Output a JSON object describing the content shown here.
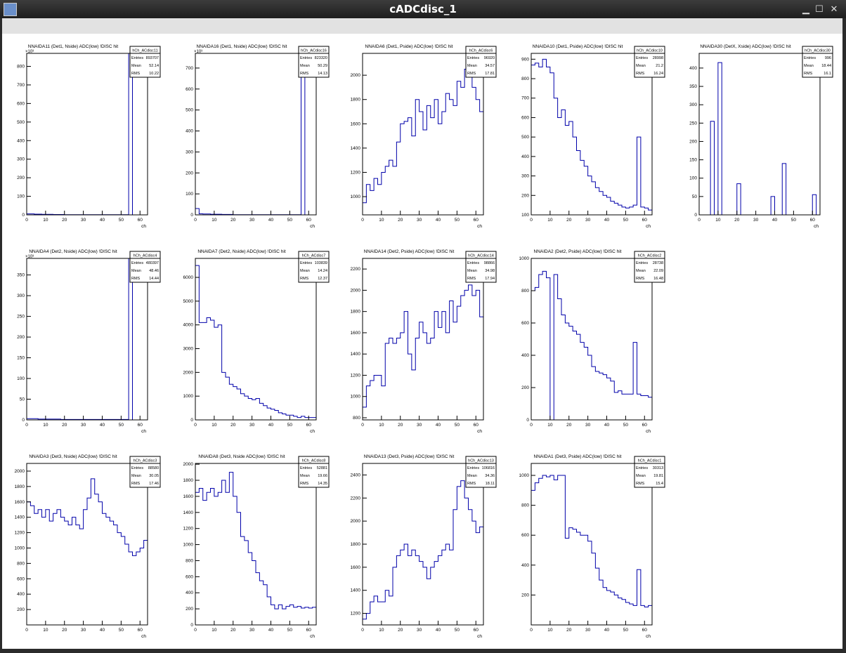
{
  "window": {
    "title": "cADCdisc_1",
    "buttons": {
      "minimize": "▁",
      "maximize": "☐",
      "close": "✕"
    }
  },
  "colors": {
    "line": "#0000aa"
  },
  "chart_data": [
    {
      "type": "bar",
      "title": "NNAIDA11 (Det1, Nside) ADC(low) !DISC hit",
      "stat_name": "hCh_ACdisc11",
      "entries": "893707",
      "mean": "52.14",
      "rms": "10.22",
      "xlabel": "ch",
      "exponent": "×10³",
      "ylim": [
        0,
        870
      ],
      "yticks": [
        0,
        100,
        200,
        300,
        400,
        500,
        600,
        700,
        800
      ],
      "values": [
        5,
        5,
        4,
        4,
        3,
        3,
        3,
        2,
        2,
        2,
        1,
        1,
        1,
        1,
        1,
        1,
        1,
        1,
        1,
        1,
        1,
        1,
        1,
        1,
        1,
        1,
        1,
        900,
        0,
        0,
        0,
        0
      ]
    },
    {
      "type": "bar",
      "title": "NNAIDA16 (Det1, Nside) ADC(low) !DISC hit",
      "stat_name": "hCh_ACdisc16",
      "entries": "823320",
      "mean": "50.29",
      "rms": "14.13",
      "xlabel": "ch",
      "exponent": "×10³",
      "ylim": [
        0,
        770
      ],
      "yticks": [
        0,
        100,
        200,
        300,
        400,
        500,
        600,
        700
      ],
      "values": [
        30,
        5,
        4,
        4,
        3,
        3,
        3,
        2,
        2,
        2,
        1,
        1,
        1,
        1,
        1,
        1,
        1,
        1,
        1,
        1,
        1,
        1,
        1,
        1,
        1,
        1,
        1,
        1,
        800,
        0,
        0,
        0
      ]
    },
    {
      "type": "bar",
      "title": "NNAIDA6 (Det1, Pside) ADC(low) !DISC hit",
      "stat_name": "hCh_ACdisc6",
      "entries": "96920",
      "mean": "34.57",
      "rms": "17.81",
      "xlabel": "ch",
      "exponent": "",
      "ylim": [
        850,
        2180
      ],
      "yticks": [
        1000,
        1200,
        1400,
        1600,
        1800,
        2000
      ],
      "values": [
        950,
        1100,
        1050,
        1150,
        1100,
        1200,
        1250,
        1300,
        1250,
        1450,
        1600,
        1620,
        1650,
        1500,
        1800,
        1700,
        1550,
        1750,
        1650,
        1800,
        1600,
        1700,
        1850,
        1800,
        1750,
        1950,
        1900,
        2050,
        2000,
        1900,
        1800,
        1700
      ]
    },
    {
      "type": "bar",
      "title": "NNAIDA10 (Det1, Pside) ADC(low) !DISC hit",
      "stat_name": "hCh_ACdisc10",
      "entries": "28998",
      "mean": "21.2",
      "rms": "16.24",
      "xlabel": "ch",
      "exponent": "",
      "ylim": [
        100,
        930
      ],
      "yticks": [
        100,
        200,
        300,
        400,
        500,
        600,
        700,
        800,
        900
      ],
      "values": [
        870,
        880,
        860,
        900,
        860,
        830,
        700,
        600,
        640,
        560,
        580,
        500,
        430,
        380,
        350,
        300,
        270,
        240,
        220,
        200,
        190,
        170,
        160,
        150,
        140,
        135,
        140,
        150,
        500,
        140,
        135,
        125
      ]
    },
    {
      "type": "bar",
      "title": "NNAIDA30 (DetX, Xside) ADC(low) !DISC hit",
      "stat_name": "hCh_ACdisc30",
      "entries": "996",
      "mean": "18.44",
      "rms": "16.1",
      "xlabel": "ch",
      "exponent": "",
      "ylim": [
        0,
        440
      ],
      "yticks": [
        0,
        50,
        100,
        150,
        200,
        250,
        300,
        350,
        400
      ],
      "values": [
        0,
        0,
        0,
        255,
        0,
        415,
        0,
        0,
        0,
        0,
        85,
        0,
        0,
        0,
        0,
        0,
        0,
        0,
        0,
        50,
        0,
        0,
        140,
        0,
        0,
        0,
        0,
        0,
        0,
        0,
        55,
        0
      ]
    },
    {
      "type": "bar",
      "title": "NNAIDA4 (Det2, Nside) ADC(low) !DISC hit",
      "stat_name": "hCh_ACdisc4",
      "entries": "480397",
      "mean": "48.46",
      "rms": "14.44",
      "xlabel": "ch",
      "exponent": "×10³",
      "ylim": [
        0,
        390
      ],
      "yticks": [
        0,
        50,
        100,
        150,
        200,
        250,
        300,
        350
      ],
      "values": [
        3,
        3,
        3,
        2,
        2,
        2,
        2,
        2,
        2,
        1,
        1,
        1,
        1,
        1,
        1,
        1,
        1,
        1,
        1,
        1,
        1,
        1,
        1,
        1,
        1,
        1,
        1,
        420,
        0,
        0,
        0,
        0
      ]
    },
    {
      "type": "bar",
      "title": "NNAIDA7 (Det2, Nside) ADC(low) !DISC hit",
      "stat_name": "hCh_ACdisc7",
      "entries": "103839",
      "mean": "14.24",
      "rms": "12.37",
      "xlabel": "ch",
      "exponent": "",
      "ylim": [
        0,
        6800
      ],
      "yticks": [
        0,
        1000,
        2000,
        3000,
        4000,
        5000,
        6000
      ],
      "values": [
        6500,
        4100,
        4100,
        4300,
        4200,
        3900,
        4000,
        2000,
        1800,
        1500,
        1400,
        1300,
        1100,
        1000,
        900,
        850,
        900,
        700,
        600,
        500,
        450,
        400,
        300,
        250,
        200,
        200,
        150,
        100,
        150,
        100,
        100,
        100
      ]
    },
    {
      "type": "bar",
      "title": "NNAIDA14 (Det2, Pside) ADC(low) !DISC hit",
      "stat_name": "hCh_ACdisc14",
      "entries": "98866",
      "mean": "34.98",
      "rms": "17.94",
      "xlabel": "ch",
      "exponent": "",
      "ylim": [
        780,
        2300
      ],
      "yticks": [
        800,
        1000,
        1200,
        1400,
        1600,
        1800,
        2000,
        2200
      ],
      "values": [
        900,
        1100,
        1150,
        1200,
        1200,
        1100,
        1500,
        1550,
        1500,
        1550,
        1600,
        1800,
        1400,
        1250,
        1550,
        1700,
        1600,
        1500,
        1550,
        1800,
        1650,
        1800,
        1600,
        1900,
        1700,
        1850,
        1950,
        2000,
        2050,
        1950,
        2000,
        1750
      ]
    },
    {
      "type": "bar",
      "title": "NNAIDA2 (Det2, Pside) ADC(low) !DISC hit",
      "stat_name": "hCh_ACdisc2",
      "entries": "28738",
      "mean": "22.09",
      "rms": "16.48",
      "xlabel": "ch",
      "exponent": "",
      "ylim": [
        0,
        1000
      ],
      "yticks": [
        0,
        200,
        400,
        600,
        800,
        1000
      ],
      "values": [
        800,
        820,
        900,
        920,
        880,
        0,
        900,
        750,
        650,
        600,
        580,
        550,
        530,
        480,
        450,
        400,
        330,
        300,
        290,
        280,
        260,
        240,
        170,
        180,
        160,
        160,
        160,
        480,
        160,
        150,
        150,
        140
      ]
    },
    {
      "type": "bar",
      "title": "NNAIDA3 (Det3, Nside) ADC(low) !DISC hit",
      "stat_name": "hCh_ACdisc3",
      "entries": "88580",
      "mean": "30.05",
      "rms": "17.46",
      "xlabel": "ch",
      "exponent": "",
      "ylim": [
        0,
        2100
      ],
      "yticks": [
        200,
        400,
        600,
        800,
        1000,
        1200,
        1400,
        1600,
        1800,
        2000
      ],
      "values": [
        1600,
        1550,
        1450,
        1500,
        1400,
        1500,
        1350,
        1450,
        1500,
        1400,
        1350,
        1300,
        1400,
        1300,
        1250,
        1500,
        1650,
        1900,
        1700,
        1600,
        1450,
        1400,
        1350,
        1300,
        1200,
        1150,
        1050,
        950,
        900,
        950,
        1000,
        1100
      ]
    },
    {
      "type": "bar",
      "title": "NNAIDA8 (Det3, Nside ADC(low) !DISC hit",
      "stat_name": "hCh_ACdisc8",
      "entries": "52881",
      "mean": "19.66",
      "rms": "14.35",
      "xlabel": "ch",
      "exponent": "",
      "ylim": [
        0,
        2010
      ],
      "yticks": [
        0,
        200,
        400,
        600,
        800,
        1000,
        1200,
        1400,
        1600,
        1800,
        2000
      ],
      "values": [
        1650,
        1700,
        1550,
        1650,
        1700,
        1600,
        1650,
        1800,
        1650,
        1900,
        1600,
        1400,
        1100,
        1050,
        900,
        800,
        650,
        550,
        500,
        350,
        250,
        200,
        250,
        200,
        230,
        250,
        220,
        230,
        210,
        220,
        210,
        220
      ]
    },
    {
      "type": "bar",
      "title": "NNAIDA13 (Det3, Pside) ADC(low) !DISC hit",
      "stat_name": "hCh_ACdisc13",
      "entries": "106816",
      "mean": "34.36",
      "rms": "18.11",
      "xlabel": "ch",
      "exponent": "",
      "ylim": [
        1100,
        2500
      ],
      "yticks": [
        1200,
        1400,
        1600,
        1800,
        2000,
        2200,
        2400
      ],
      "values": [
        1150,
        1200,
        1300,
        1350,
        1300,
        1300,
        1400,
        1350,
        1600,
        1700,
        1750,
        1800,
        1700,
        1750,
        1700,
        1650,
        1600,
        1500,
        1600,
        1650,
        1700,
        1750,
        1800,
        1750,
        2100,
        2300,
        2350,
        2200,
        2100,
        2000,
        1900,
        1950
      ]
    },
    {
      "type": "bar",
      "title": "NNAIDA1 (Det3, Pside) ADC(low) !DISC hit",
      "stat_name": "hCh_ACdisc1",
      "entries": "30313",
      "mean": "19.81",
      "rms": "15.4",
      "xlabel": "ch",
      "exponent": "",
      "ylim": [
        0,
        1080
      ],
      "yticks": [
        200,
        400,
        600,
        800,
        1000
      ],
      "values": [
        900,
        950,
        980,
        1000,
        990,
        1000,
        970,
        1000,
        1000,
        580,
        650,
        640,
        620,
        600,
        600,
        560,
        480,
        380,
        300,
        250,
        230,
        220,
        200,
        180,
        170,
        150,
        140,
        130,
        370,
        130,
        120,
        130
      ]
    }
  ],
  "stats_labels": {
    "entries": "Entries",
    "mean": "Mean",
    "rms": "RMS"
  },
  "xticks": [
    0,
    10,
    20,
    30,
    40,
    50,
    60
  ]
}
